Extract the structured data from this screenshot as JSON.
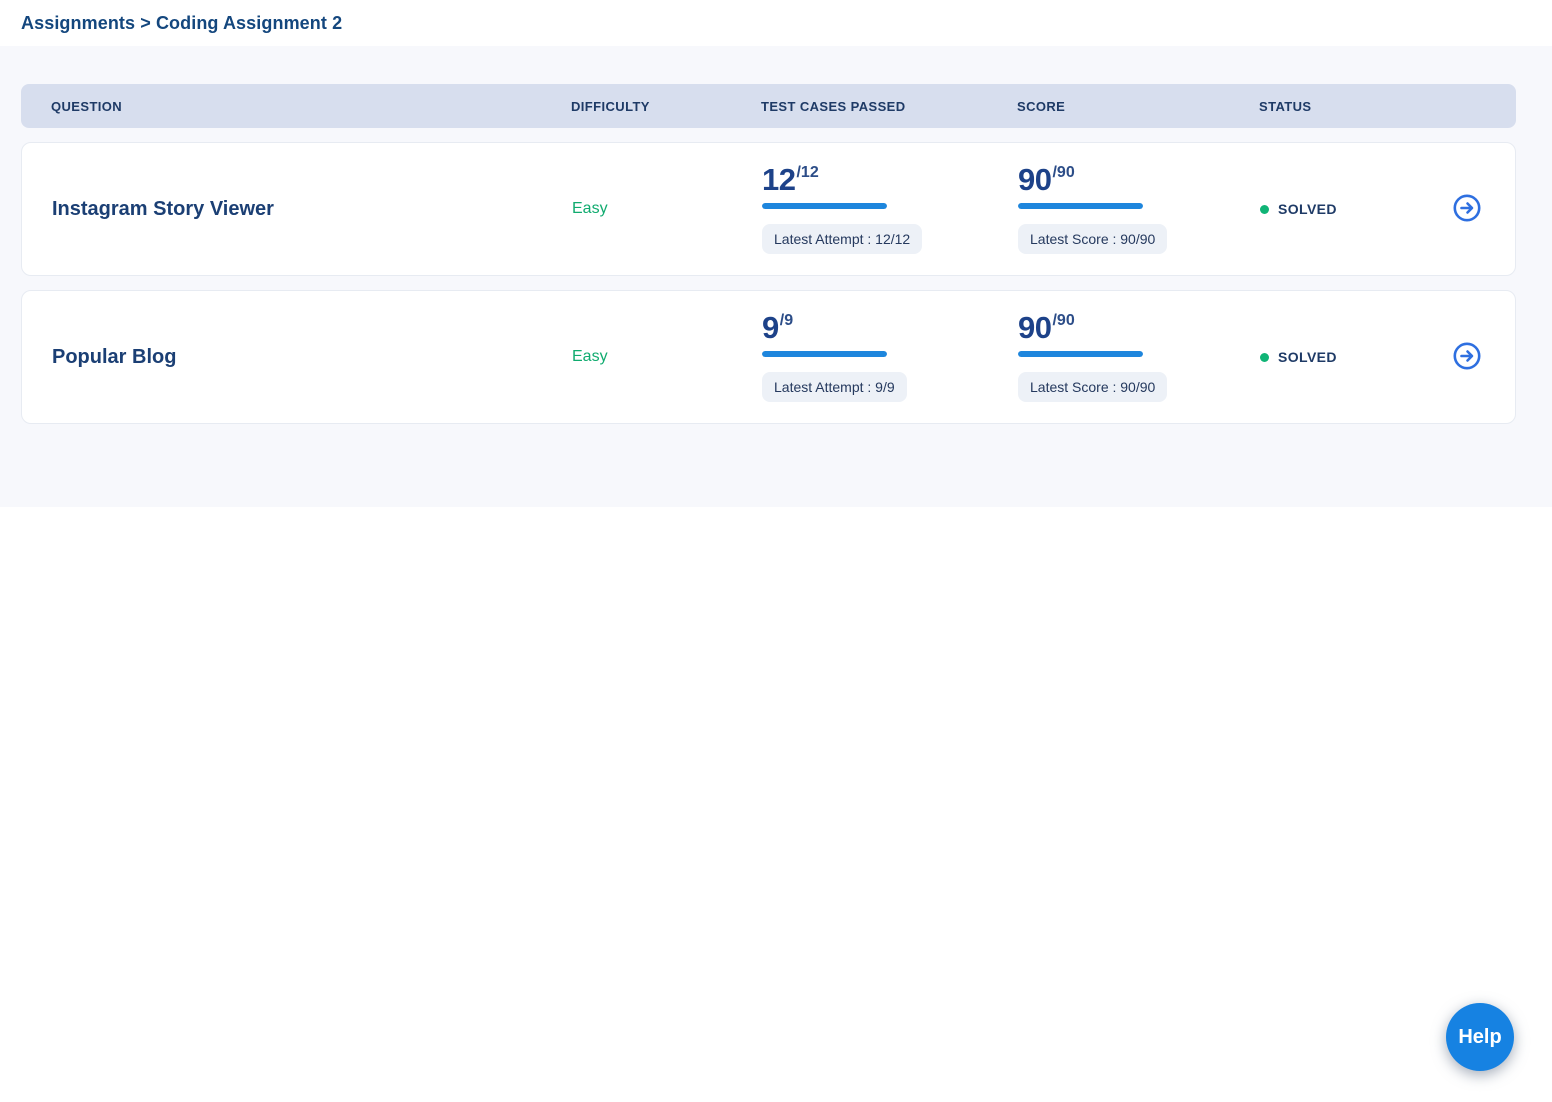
{
  "breadcrumb": "Assignments > Coding Assignment 2",
  "table": {
    "columns": [
      "QUESTION",
      "DIFFICULTY",
      "TEST CASES PASSED",
      "SCORE",
      "STATUS"
    ],
    "rows": [
      {
        "question": "Instagram Story Viewer",
        "difficulty": "Easy",
        "test_cases": {
          "passed": "12",
          "total": "/12",
          "percent": 100,
          "latest_label": "Latest Attempt : 12/12"
        },
        "score": {
          "earned": "90",
          "total": "/90",
          "percent": 100,
          "latest_label": "Latest Score : 90/90"
        },
        "status": "SOLVED"
      },
      {
        "question": "Popular Blog",
        "difficulty": "Easy",
        "test_cases": {
          "passed": "9",
          "total": "/9",
          "percent": 100,
          "latest_label": "Latest Attempt : 9/9"
        },
        "score": {
          "earned": "90",
          "total": "/90",
          "percent": 100,
          "latest_label": "Latest Score : 90/90"
        },
        "status": "SOLVED"
      }
    ]
  },
  "help_button": {
    "label": "Help"
  },
  "colors": {
    "accent_blue": "#1e86dd",
    "navy_text": "#1d4289",
    "green_status": "#10b476",
    "header_bg": "#d7deee",
    "page_section_bg": "#f7f8fc",
    "help_bg": "#1682e2"
  }
}
